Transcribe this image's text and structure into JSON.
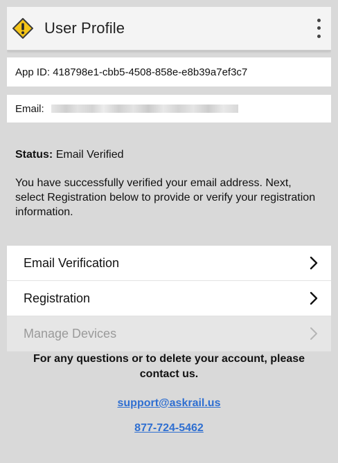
{
  "header": {
    "title": "User Profile",
    "logo_icon": "warning-diamond-icon",
    "menu_icon": "more-vertical-icon"
  },
  "profile": {
    "app_id_label": "App ID:",
    "app_id_value": "418798e1-cbb5-4508-858e-e8b39a7ef3c7",
    "email_label": "Email:"
  },
  "status": {
    "label": "Status:",
    "value": "Email Verified",
    "description": "You have successfully verified your email address. Next, select Registration below to provide or verify your registration information."
  },
  "nav": {
    "items": [
      {
        "label": "Email Verification",
        "enabled": true
      },
      {
        "label": "Registration",
        "enabled": true
      },
      {
        "label": "Manage Devices",
        "enabled": false
      }
    ]
  },
  "footer": {
    "message": "For any questions or to delete your account, please contact us.",
    "email_link": "support@askrail.us",
    "phone_link": "877-724-5462"
  },
  "colors": {
    "brand_yellow": "#f5c518",
    "link_blue": "#2f6fd1",
    "background_gray": "#d9d9d9"
  }
}
